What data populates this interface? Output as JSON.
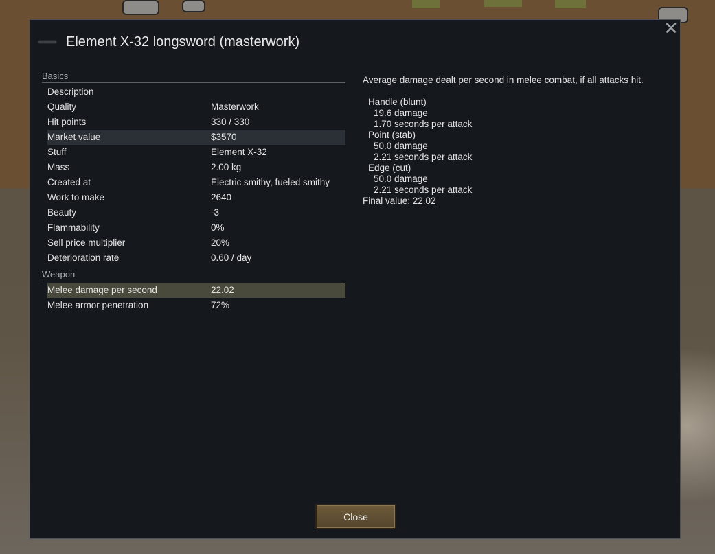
{
  "dialog": {
    "title": "Element X-32 longsword (masterwork)",
    "close_x": "✕",
    "close_button": "Close"
  },
  "sections": [
    {
      "name": "Basics",
      "rows": [
        {
          "label": "Description",
          "value": ""
        },
        {
          "label": "Quality",
          "value": "Masterwork"
        },
        {
          "label": "Hit points",
          "value": "330 / 330"
        },
        {
          "label": "Market value",
          "value": "$3570"
        },
        {
          "label": "Stuff",
          "value": "Element X-32"
        },
        {
          "label": "Mass",
          "value": "2.00 kg"
        },
        {
          "label": "Created at",
          "value": "Electric smithy, fueled smithy"
        },
        {
          "label": "Work to make",
          "value": "2640"
        },
        {
          "label": "Beauty",
          "value": "-3"
        },
        {
          "label": "Flammability",
          "value": "0%"
        },
        {
          "label": "Sell price multiplier",
          "value": "20%"
        },
        {
          "label": "Deterioration rate",
          "value": "0.60 / day"
        }
      ]
    },
    {
      "name": "Weapon",
      "rows": [
        {
          "label": "Melee damage per second",
          "value": "22.02"
        },
        {
          "label": "Melee armor penetration",
          "value": "72%"
        }
      ]
    }
  ],
  "detail": {
    "description": "Average damage dealt per second in melee combat, if all attacks hit.",
    "tools": [
      {
        "name": "Handle (blunt)",
        "damage": "19.6 damage",
        "cooldown": "1.70 seconds per attack"
      },
      {
        "name": "Point (stab)",
        "damage": "50.0 damage",
        "cooldown": "2.21 seconds per attack"
      },
      {
        "name": "Edge (cut)",
        "damage": "50.0 damage",
        "cooldown": "2.21 seconds per attack"
      }
    ],
    "final": "Final value: 22.02"
  }
}
